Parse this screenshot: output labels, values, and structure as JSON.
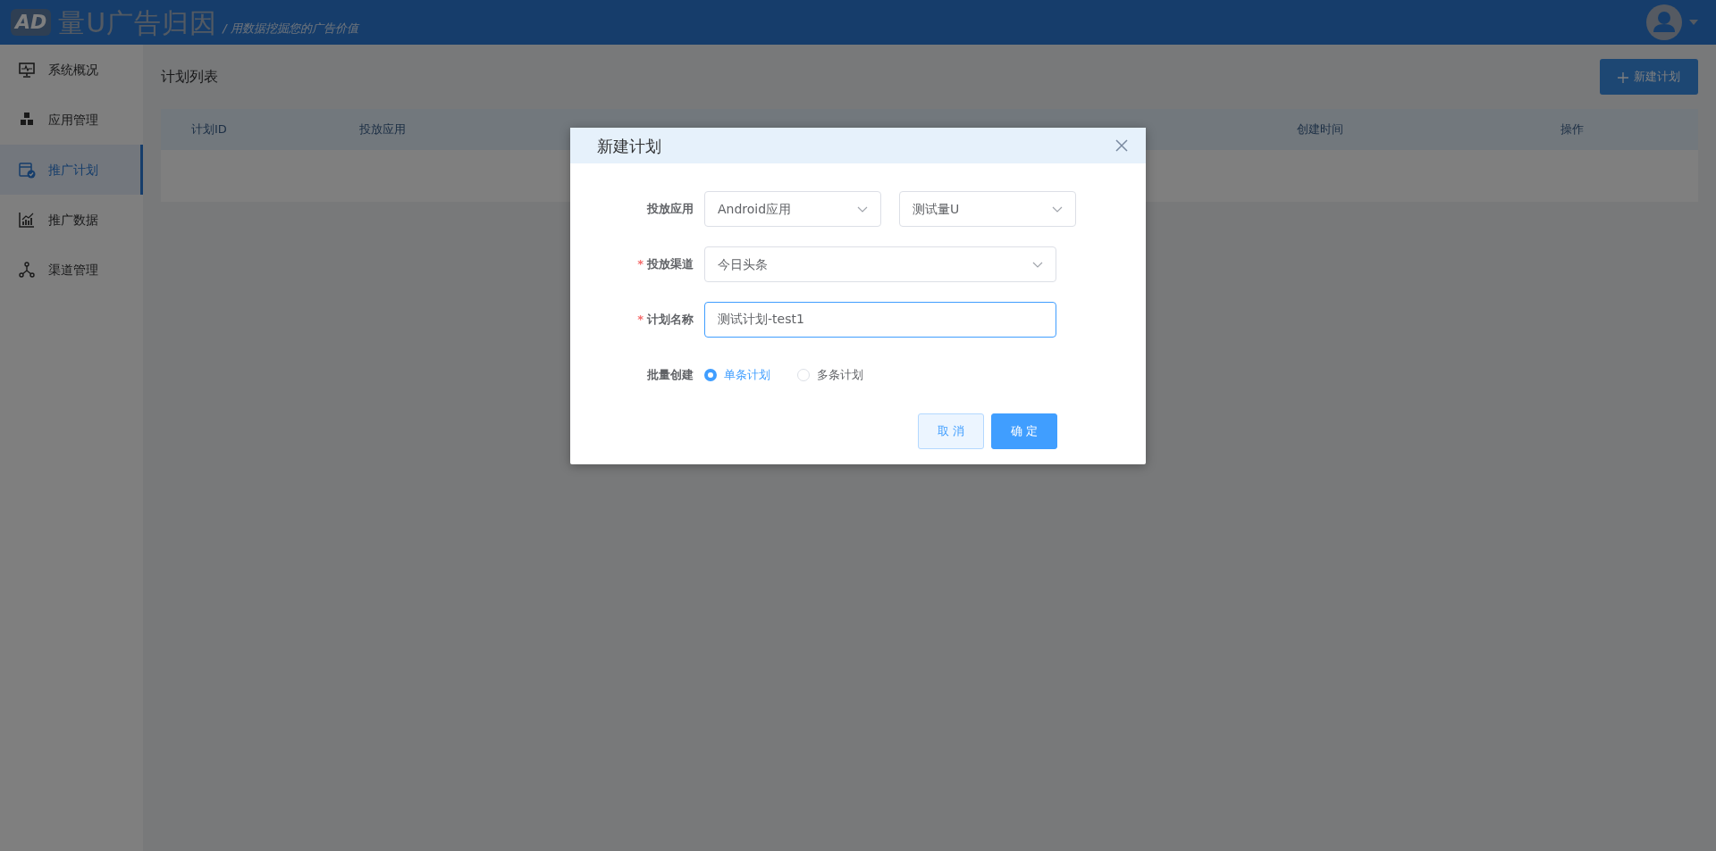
{
  "header": {
    "logo_badge": "AD",
    "brand": "量U广告归因",
    "slogan": "/ 用数据挖掘您的广告价值"
  },
  "sidebar": {
    "items": [
      {
        "label": "系统概况",
        "kind": "monitor",
        "selected": false
      },
      {
        "label": "应用管理",
        "kind": "cubes",
        "selected": false
      },
      {
        "label": "推广计划",
        "kind": "calendar",
        "selected": true
      },
      {
        "label": "推广数据",
        "kind": "chart",
        "selected": false
      },
      {
        "label": "渠道管理",
        "kind": "network",
        "selected": false
      }
    ]
  },
  "page": {
    "title": "计划列表",
    "new_button": "新建计划"
  },
  "table": {
    "columns": [
      "计划ID",
      "投放应用",
      "创建时间",
      "操作"
    ]
  },
  "dialog": {
    "title": "新建计划",
    "fields": [
      {
        "label": "投放应用",
        "kind": "selects",
        "values": [
          "Android应用",
          "测试量U"
        ]
      },
      {
        "label": "投放渠道",
        "required_mark": "*",
        "kind": "select",
        "values": [
          "今日头条"
        ]
      },
      {
        "label": "计划名称",
        "required_mark": "*",
        "kind": "input",
        "values": [
          "测试计划-test1"
        ]
      }
    ],
    "radio": {
      "label": "批量创建",
      "options": [
        {
          "label": "单条计划",
          "selected": true
        },
        {
          "label": "多条计划",
          "selected": false
        }
      ]
    },
    "buttons": [
      {
        "label": "取 消",
        "kind": "secondary"
      },
      {
        "label": "确 定",
        "kind": "primary"
      }
    ]
  }
}
